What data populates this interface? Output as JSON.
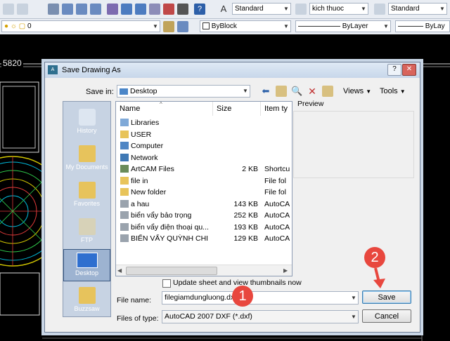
{
  "toolbar1": {
    "text_style": "Standard",
    "dim_style": "kich thuoc",
    "table_style": "Standard"
  },
  "toolbar2": {
    "layer": "0",
    "color": "ByBlock",
    "linetype": "ByLayer",
    "lineweight": "ByLay"
  },
  "canvas": {
    "dimension_text": "5820"
  },
  "dialog": {
    "title": "Save Drawing As",
    "save_in_label": "Save in:",
    "save_in_value": "Desktop",
    "views_label": "Views",
    "tools_label": "Tools",
    "preview_label": "Preview",
    "places": [
      "History",
      "My Documents",
      "Favorites",
      "FTP",
      "Desktop",
      "Buzzsaw"
    ],
    "columns": {
      "name": "Name",
      "size": "Size",
      "type": "Item ty"
    },
    "files": [
      {
        "name": "Libraries",
        "size": "",
        "type": "",
        "icon": "libraries-icon"
      },
      {
        "name": "USER",
        "size": "",
        "type": "",
        "icon": "folder-icon"
      },
      {
        "name": "Computer",
        "size": "",
        "type": "",
        "icon": "computer-icon"
      },
      {
        "name": "Network",
        "size": "",
        "type": "",
        "icon": "network-icon"
      },
      {
        "name": "ArtCAM Files",
        "size": "2 KB",
        "type": "Shortcu",
        "icon": "shortcut-icon"
      },
      {
        "name": "file in",
        "size": "",
        "type": "File fol",
        "icon": "folder-icon"
      },
      {
        "name": "New folder",
        "size": "",
        "type": "File fol",
        "icon": "folder-icon"
      },
      {
        "name": "a hau",
        "size": "143 KB",
        "type": "AutoCA",
        "icon": "dxf-icon"
      },
      {
        "name": "biển vẩy bảo trọng",
        "size": "252 KB",
        "type": "AutoCA",
        "icon": "dxf-icon"
      },
      {
        "name": "biển vẩy điện thoại qu...",
        "size": "193 KB",
        "type": "AutoCA",
        "icon": "dxf-icon"
      },
      {
        "name": "BIỂN VẨY QUỲNH CHI",
        "size": "129 KB",
        "type": "AutoCA",
        "icon": "dxf-icon"
      }
    ],
    "thumbnail_option": "Update sheet and view thumbnails now",
    "file_name_label": "File name:",
    "file_name_value": "filegiamdungluong.dxf",
    "file_type_label": "Files of type:",
    "file_type_value": "AutoCAD 2007 DXF (*.dxf)",
    "save_button": "Save",
    "cancel_button": "Cancel"
  },
  "annotations": {
    "step1": "1",
    "step2": "2"
  }
}
